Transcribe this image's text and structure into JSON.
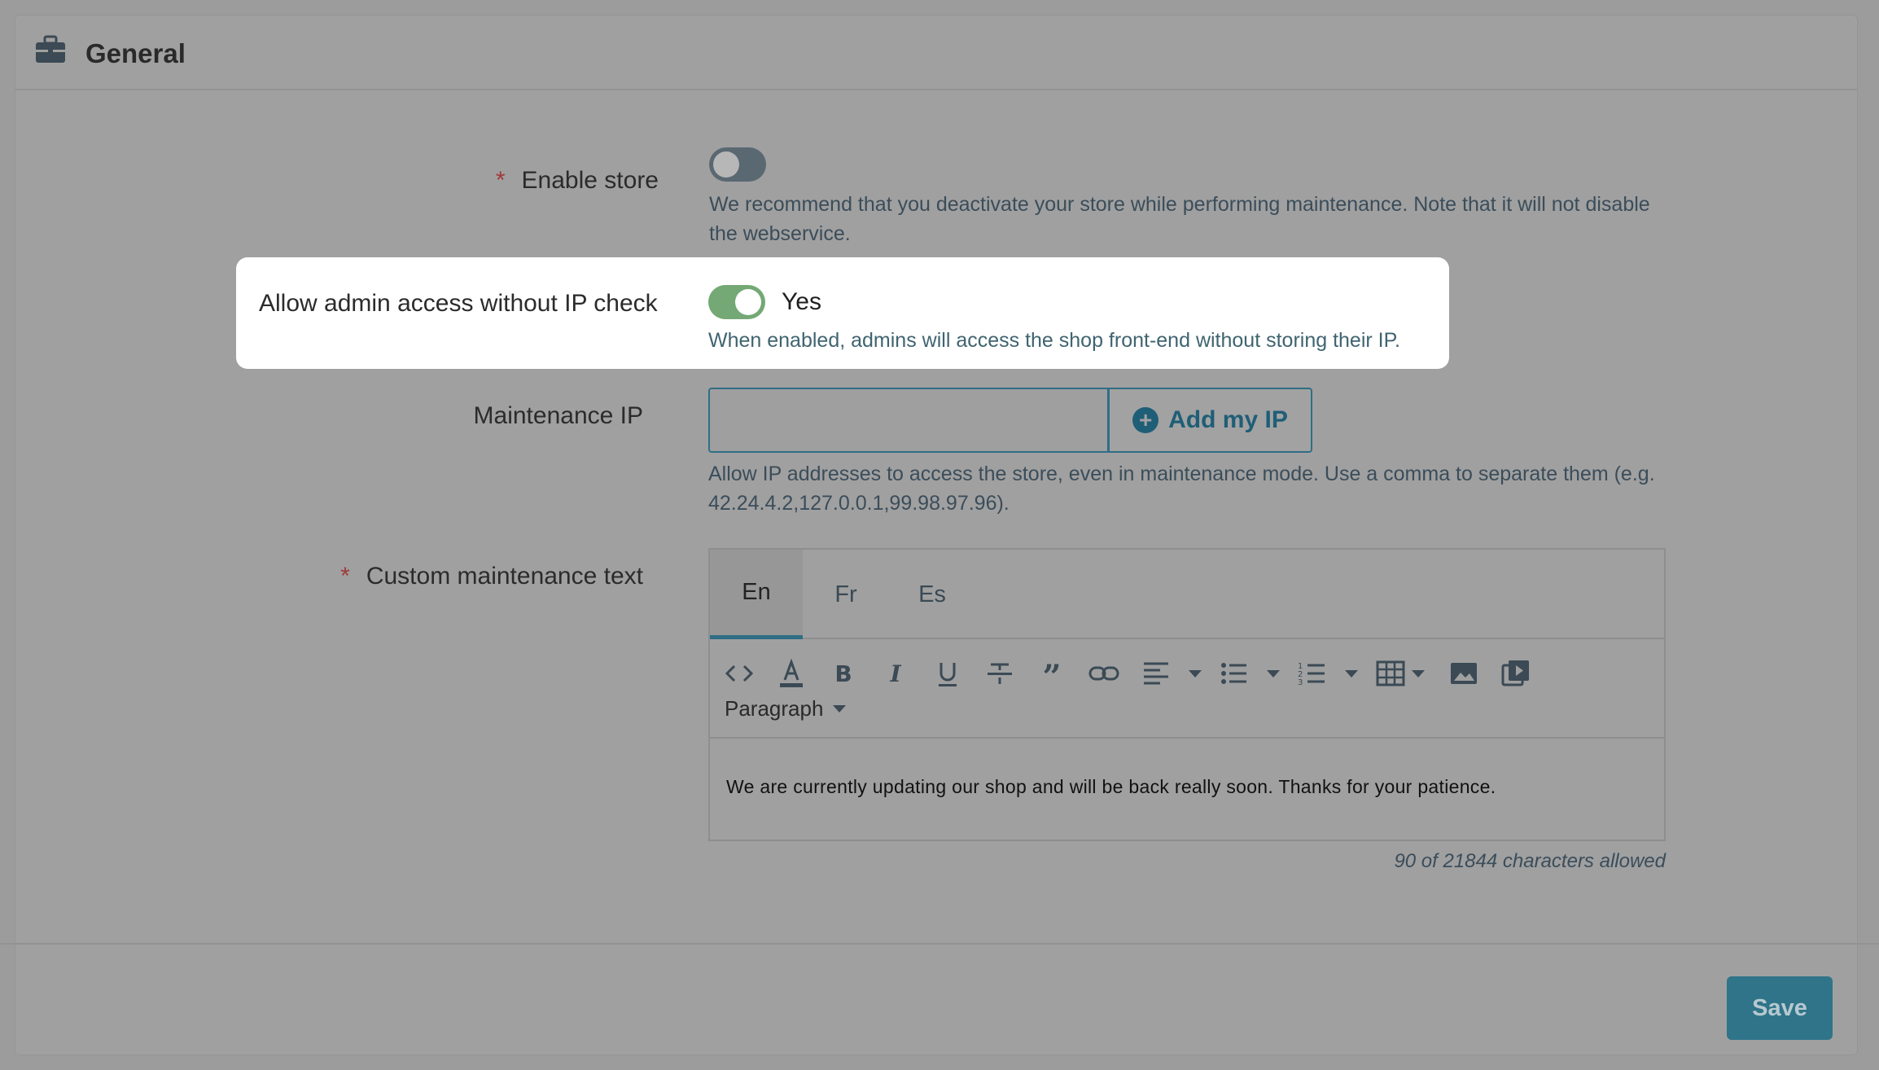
{
  "header": {
    "title": "General",
    "icon": "briefcase-icon"
  },
  "fields": {
    "enable_store": {
      "label": "Enable store",
      "required_mark": "*",
      "state": "off",
      "help": "We recommend that you deactivate your store while performing maintenance. Note that it will not disable the webservice."
    },
    "allow_admin": {
      "label": "Allow admin access without IP check",
      "state": "on",
      "state_label": "Yes",
      "help": "When enabled, admins will access the shop front-end without storing their IP."
    },
    "maintenance_ip": {
      "label": "Maintenance IP",
      "value": "",
      "button_label": "Add my IP",
      "help_line1": "Allow IP addresses to access the store, even in maintenance mode. Use a comma to separate them (e.g.",
      "help_line2": "42.24.4.2,127.0.0.1,99.98.97.96)."
    },
    "custom_text": {
      "label": "Custom maintenance text",
      "required_mark": "*",
      "tabs": [
        "En",
        "Fr",
        "Es"
      ],
      "active_tab": "En",
      "block_format": "Paragraph",
      "content": "We are currently updating our shop and will be back really soon. Thanks for your patience.",
      "counter": "90 of 21844 characters allowed"
    }
  },
  "footer": {
    "save_label": "Save"
  },
  "colors": {
    "accent": "#2f6e85",
    "toggle_on": "#74a874",
    "required": "#a13a3a"
  }
}
